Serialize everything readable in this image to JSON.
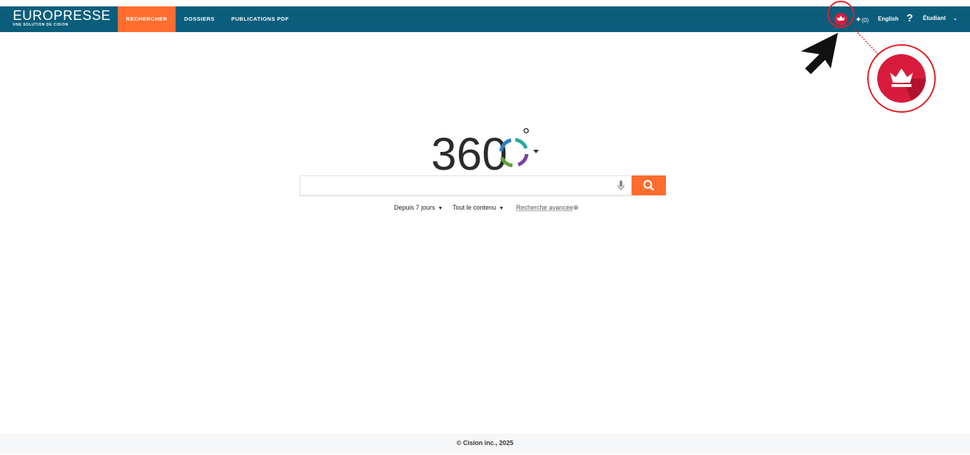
{
  "brand": {
    "name": "EUROPRESSE",
    "tagline": "UNE SOLUTION DE CISION"
  },
  "nav": {
    "tabs": [
      {
        "label": "RECHERCHER",
        "active": true
      },
      {
        "label": "DOSSIERS",
        "active": false
      },
      {
        "label": "PUBLICATIONS PDF",
        "active": false
      }
    ]
  },
  "header_right": {
    "premium_icon": "crown-icon",
    "pinned_count": "(0)",
    "language": "English",
    "help": "?",
    "user": "Étudiant"
  },
  "search": {
    "logo_text": "360",
    "logo_degree": "°",
    "placeholder": "",
    "value": "",
    "filters": {
      "date": "Depuis 7 jours",
      "content": "Tout le contenu",
      "advanced": "Recherche avancée"
    }
  },
  "footer": {
    "copyright": "© Cision inc., 2025"
  },
  "colors": {
    "header_bg": "#0b5d7c",
    "accent": "#ff6d2e",
    "crown": "#d81b3d",
    "annotation": "#e31e24"
  }
}
